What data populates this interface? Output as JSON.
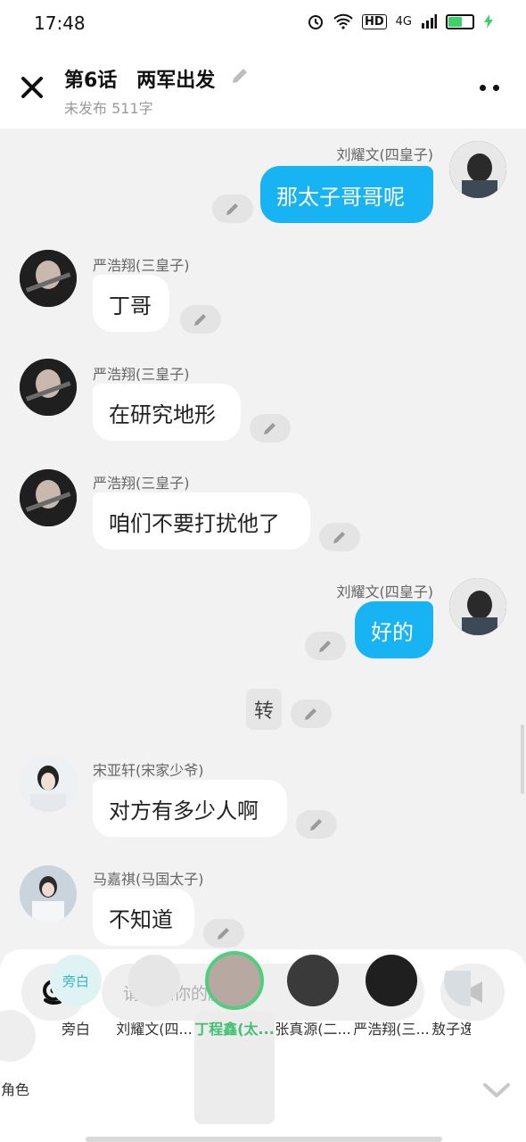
{
  "status": {
    "time": "17:48",
    "hd": "HD",
    "network": "4G"
  },
  "header": {
    "title": "第6话　两军出发",
    "subtitle": "未发布 511字"
  },
  "messages": [
    {
      "speaker": "刘耀文(四皇子)",
      "text": "那太子哥哥呢"
    },
    {
      "speaker": "严浩翔(三皇子)",
      "text": "丁哥"
    },
    {
      "speaker": "严浩翔(三皇子)",
      "text": "在研究地形"
    },
    {
      "speaker": "严浩翔(三皇子)",
      "text": "咱们不要打扰他了"
    },
    {
      "speaker": "刘耀文(四皇子)",
      "text": "好的"
    },
    {
      "speaker": "宋亚轩(宋家少爷)",
      "text": "对方有多少人啊"
    },
    {
      "speaker": "马嘉祺(马国太子)",
      "text": "不知道"
    }
  ],
  "narration": {
    "text": "转"
  },
  "composer": {
    "placeholder": "请输入你的脑洞~"
  },
  "roles": [
    {
      "name": "角色"
    },
    {
      "name": "旁白",
      "avatar_text": "旁白"
    },
    {
      "name": "刘耀文(四..."
    },
    {
      "name": "丁程鑫(太..."
    },
    {
      "name": "张真源(二..."
    },
    {
      "name": "严浩翔(三..."
    },
    {
      "name": "敖子逸"
    }
  ],
  "colors": {
    "accent": "#17b3f2",
    "selected": "#41c06f"
  }
}
